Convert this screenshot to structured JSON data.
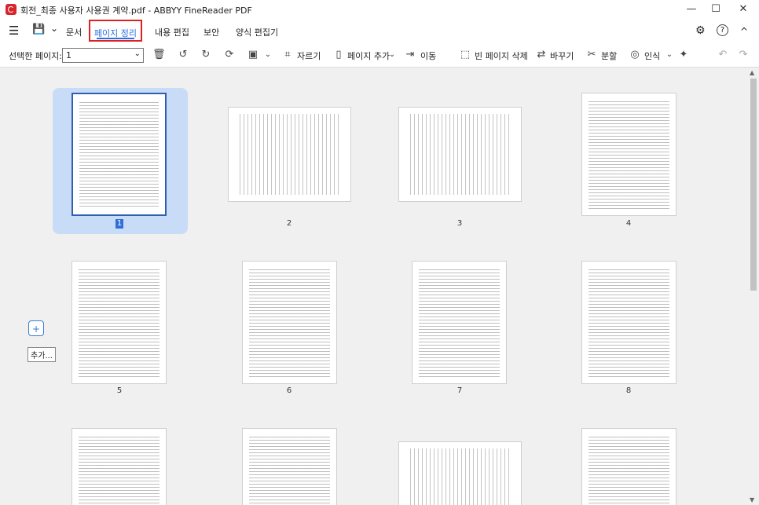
{
  "titlebar": {
    "title": "회전_최종 사용자 사용권 계약.pdf - ABBYY FineReader PDF",
    "minimize": "—",
    "maximize": "☐",
    "close": "✕"
  },
  "menu": {
    "hamburger": "☰",
    "save": "💾",
    "save_chevron": "⌄",
    "items": [
      "문서",
      "페이지 정리",
      "내용 편집",
      "보안",
      "양식 편집기"
    ],
    "active_index": 1,
    "settings_icon": "⚙",
    "help_icon": "?",
    "collapse_icon": "^"
  },
  "toolbar": {
    "selected_pages_label": "선택한 페이지:",
    "selected_pages_value": "1",
    "crop": "자르기",
    "add_page": "페이지 추가",
    "move": "이동",
    "delete_blank": "빈 페이지 삭제",
    "replace": "바꾸기",
    "split": "분할",
    "recognize": "인식"
  },
  "pages": [
    {
      "number": "1",
      "selected": true,
      "layout": "portrait"
    },
    {
      "number": "2",
      "selected": false,
      "layout": "landscape"
    },
    {
      "number": "3",
      "selected": false,
      "layout": "landscape"
    },
    {
      "number": "4",
      "selected": false,
      "layout": "portrait"
    },
    {
      "number": "5",
      "selected": false,
      "layout": "portrait"
    },
    {
      "number": "6",
      "selected": false,
      "layout": "portrait"
    },
    {
      "number": "7",
      "selected": false,
      "layout": "portrait"
    },
    {
      "number": "8",
      "selected": false,
      "layout": "portrait"
    }
  ],
  "side": {
    "add_tooltip": "추가..."
  }
}
